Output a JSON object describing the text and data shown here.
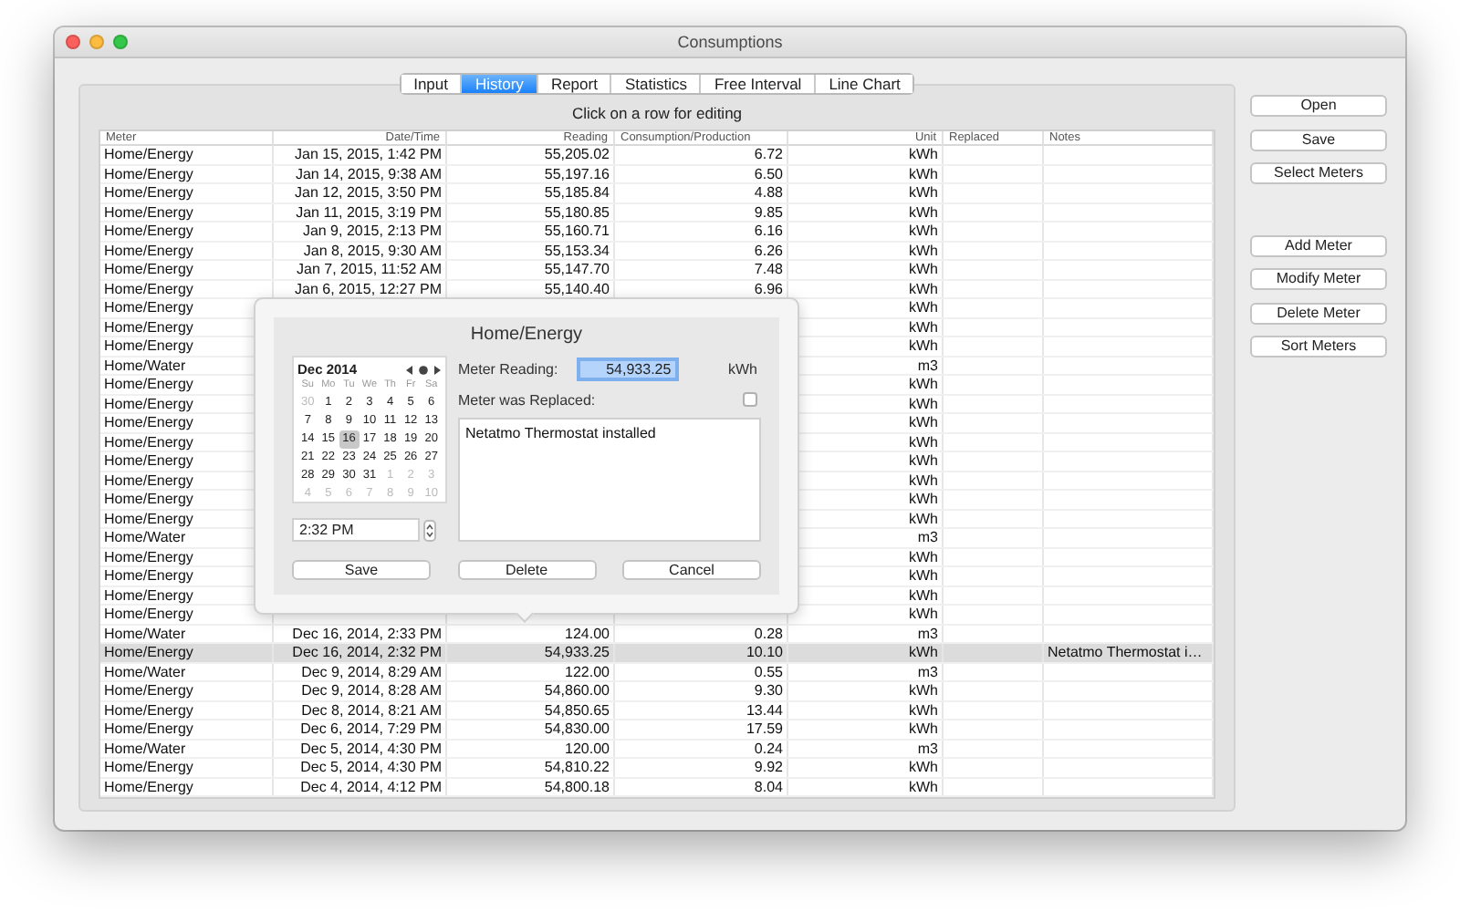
{
  "window": {
    "title": "Consumptions"
  },
  "tabs": [
    {
      "label": "Input",
      "selected": false
    },
    {
      "label": "History",
      "selected": true
    },
    {
      "label": "Report",
      "selected": false
    },
    {
      "label": "Statistics",
      "selected": false
    },
    {
      "label": "Free Interval",
      "selected": false
    },
    {
      "label": "Line Chart",
      "selected": false
    }
  ],
  "hint": "Click on a row for editing",
  "table": {
    "columns": [
      "Meter",
      "Date/Time",
      "Reading",
      "Consumption/Production",
      "Unit",
      "Replaced",
      "Notes"
    ],
    "rows": [
      {
        "meter": "Home/Energy",
        "datetime": "Jan 15, 2015, 1:42 PM",
        "reading": "55,205.02",
        "consumption": "6.72",
        "unit": "kWh",
        "selected": false
      },
      {
        "meter": "Home/Energy",
        "datetime": "Jan 14, 2015, 9:38 AM",
        "reading": "55,197.16",
        "consumption": "6.50",
        "unit": "kWh",
        "selected": false
      },
      {
        "meter": "Home/Energy",
        "datetime": "Jan 12, 2015, 3:50 PM",
        "reading": "55,185.84",
        "consumption": "4.88",
        "unit": "kWh",
        "selected": false
      },
      {
        "meter": "Home/Energy",
        "datetime": "Jan 11, 2015, 3:19 PM",
        "reading": "55,180.85",
        "consumption": "9.85",
        "unit": "kWh",
        "selected": false
      },
      {
        "meter": "Home/Energy",
        "datetime": "Jan 9, 2015, 2:13 PM",
        "reading": "55,160.71",
        "consumption": "6.16",
        "unit": "kWh",
        "selected": false
      },
      {
        "meter": "Home/Energy",
        "datetime": "Jan 8, 2015, 9:30 AM",
        "reading": "55,153.34",
        "consumption": "6.26",
        "unit": "kWh",
        "selected": false
      },
      {
        "meter": "Home/Energy",
        "datetime": "Jan 7, 2015, 11:52 AM",
        "reading": "55,147.70",
        "consumption": "7.48",
        "unit": "kWh",
        "selected": false
      },
      {
        "meter": "Home/Energy",
        "datetime": "Jan 6, 2015, 12:27 PM",
        "reading": "55,140.40",
        "consumption": "6.96",
        "unit": "kWh",
        "selected": false
      },
      {
        "meter": "Home/Energy",
        "unit": "kWh",
        "selected": false
      },
      {
        "meter": "Home/Energy",
        "unit": "kWh",
        "selected": false
      },
      {
        "meter": "Home/Energy",
        "unit": "kWh",
        "selected": false
      },
      {
        "meter": "Home/Water",
        "unit": "m3",
        "selected": false
      },
      {
        "meter": "Home/Energy",
        "unit": "kWh",
        "selected": false
      },
      {
        "meter": "Home/Energy",
        "unit": "kWh",
        "selected": false
      },
      {
        "meter": "Home/Energy",
        "unit": "kWh",
        "selected": false
      },
      {
        "meter": "Home/Energy",
        "unit": "kWh",
        "selected": false
      },
      {
        "meter": "Home/Energy",
        "unit": "kWh",
        "selected": false
      },
      {
        "meter": "Home/Energy",
        "unit": "kWh",
        "selected": false
      },
      {
        "meter": "Home/Energy",
        "unit": "kWh",
        "selected": false
      },
      {
        "meter": "Home/Energy",
        "unit": "kWh",
        "selected": false
      },
      {
        "meter": "Home/Water",
        "unit": "m3",
        "selected": false
      },
      {
        "meter": "Home/Energy",
        "unit": "kWh",
        "selected": false
      },
      {
        "meter": "Home/Energy",
        "unit": "kWh",
        "selected": false
      },
      {
        "meter": "Home/Energy",
        "unit": "kWh",
        "selected": false
      },
      {
        "meter": "Home/Energy",
        "unit": "kWh",
        "selected": false
      },
      {
        "meter": "Home/Water",
        "datetime": "Dec 16, 2014, 2:33 PM",
        "reading": "124.00",
        "consumption": "0.28",
        "unit": "m3",
        "selected": false
      },
      {
        "meter": "Home/Energy",
        "datetime": "Dec 16, 2014, 2:32 PM",
        "reading": "54,933.25",
        "consumption": "10.10",
        "unit": "kWh",
        "notes": "Netatmo Thermostat i…",
        "selected": true
      },
      {
        "meter": "Home/Water",
        "datetime": "Dec 9, 2014, 8:29 AM",
        "reading": "122.00",
        "consumption": "0.55",
        "unit": "m3",
        "selected": false
      },
      {
        "meter": "Home/Energy",
        "datetime": "Dec 9, 2014, 8:28 AM",
        "reading": "54,860.00",
        "consumption": "9.30",
        "unit": "kWh",
        "selected": false
      },
      {
        "meter": "Home/Energy",
        "datetime": "Dec 8, 2014, 8:21 AM",
        "reading": "54,850.65",
        "consumption": "13.44",
        "unit": "kWh",
        "selected": false
      },
      {
        "meter": "Home/Energy",
        "datetime": "Dec 6, 2014, 7:29 PM",
        "reading": "54,830.00",
        "consumption": "17.59",
        "unit": "kWh",
        "selected": false
      },
      {
        "meter": "Home/Water",
        "datetime": "Dec 5, 2014, 4:30 PM",
        "reading": "120.00",
        "consumption": "0.24",
        "unit": "m3",
        "selected": false
      },
      {
        "meter": "Home/Energy",
        "datetime": "Dec 5, 2014, 4:30 PM",
        "reading": "54,810.22",
        "consumption": "9.92",
        "unit": "kWh",
        "selected": false
      },
      {
        "meter": "Home/Energy",
        "datetime": "Dec 4, 2014, 4:12 PM",
        "reading": "54,800.18",
        "consumption": "8.04",
        "unit": "kWh",
        "selected": false
      }
    ]
  },
  "editor": {
    "title": "Home/Energy",
    "calendar": {
      "month": "Dec 2014",
      "weekdays": [
        "Su",
        "Mo",
        "Tu",
        "We",
        "Th",
        "Fr",
        "Sa"
      ],
      "days": [
        {
          "label": "30",
          "outside": true,
          "selected": false
        },
        {
          "label": "1",
          "outside": false,
          "selected": false
        },
        {
          "label": "2",
          "outside": false,
          "selected": false
        },
        {
          "label": "3",
          "outside": false,
          "selected": false
        },
        {
          "label": "4",
          "outside": false,
          "selected": false
        },
        {
          "label": "5",
          "outside": false,
          "selected": false
        },
        {
          "label": "6",
          "outside": false,
          "selected": false
        },
        {
          "label": "7",
          "outside": false,
          "selected": false
        },
        {
          "label": "8",
          "outside": false,
          "selected": false
        },
        {
          "label": "9",
          "outside": false,
          "selected": false
        },
        {
          "label": "10",
          "outside": false,
          "selected": false
        },
        {
          "label": "11",
          "outside": false,
          "selected": false
        },
        {
          "label": "12",
          "outside": false,
          "selected": false
        },
        {
          "label": "13",
          "outside": false,
          "selected": false
        },
        {
          "label": "14",
          "outside": false,
          "selected": false
        },
        {
          "label": "15",
          "outside": false,
          "selected": false
        },
        {
          "label": "16",
          "outside": false,
          "selected": true
        },
        {
          "label": "17",
          "outside": false,
          "selected": false
        },
        {
          "label": "18",
          "outside": false,
          "selected": false
        },
        {
          "label": "19",
          "outside": false,
          "selected": false
        },
        {
          "label": "20",
          "outside": false,
          "selected": false
        },
        {
          "label": "21",
          "outside": false,
          "selected": false
        },
        {
          "label": "22",
          "outside": false,
          "selected": false
        },
        {
          "label": "23",
          "outside": false,
          "selected": false
        },
        {
          "label": "24",
          "outside": false,
          "selected": false
        },
        {
          "label": "25",
          "outside": false,
          "selected": false
        },
        {
          "label": "26",
          "outside": false,
          "selected": false
        },
        {
          "label": "27",
          "outside": false,
          "selected": false
        },
        {
          "label": "28",
          "outside": false,
          "selected": false
        },
        {
          "label": "29",
          "outside": false,
          "selected": false
        },
        {
          "label": "30",
          "outside": false,
          "selected": false
        },
        {
          "label": "31",
          "outside": false,
          "selected": false
        },
        {
          "label": "1",
          "outside": true,
          "selected": false
        },
        {
          "label": "2",
          "outside": true,
          "selected": false
        },
        {
          "label": "3",
          "outside": true,
          "selected": false
        },
        {
          "label": "4",
          "outside": true,
          "selected": false
        },
        {
          "label": "5",
          "outside": true,
          "selected": false
        },
        {
          "label": "6",
          "outside": true,
          "selected": false
        },
        {
          "label": "7",
          "outside": true,
          "selected": false
        },
        {
          "label": "8",
          "outside": true,
          "selected": false
        },
        {
          "label": "9",
          "outside": true,
          "selected": false
        },
        {
          "label": "10",
          "outside": true,
          "selected": false
        }
      ]
    },
    "time": "2:32 PM",
    "reading_label": "Meter Reading:",
    "reading": "54,933.25",
    "unit": "kWh",
    "replaced_label": "Meter was Replaced:",
    "replaced": false,
    "notes": "Netatmo Thermostat installed",
    "buttons": [
      "Save",
      "Delete",
      "Cancel"
    ]
  },
  "side_buttons": {
    "file": [
      "Open",
      "Save",
      "Select Meters"
    ],
    "meters": [
      "Add Meter",
      "Modify Meter",
      "Delete Meter",
      "Sort Meters"
    ]
  }
}
